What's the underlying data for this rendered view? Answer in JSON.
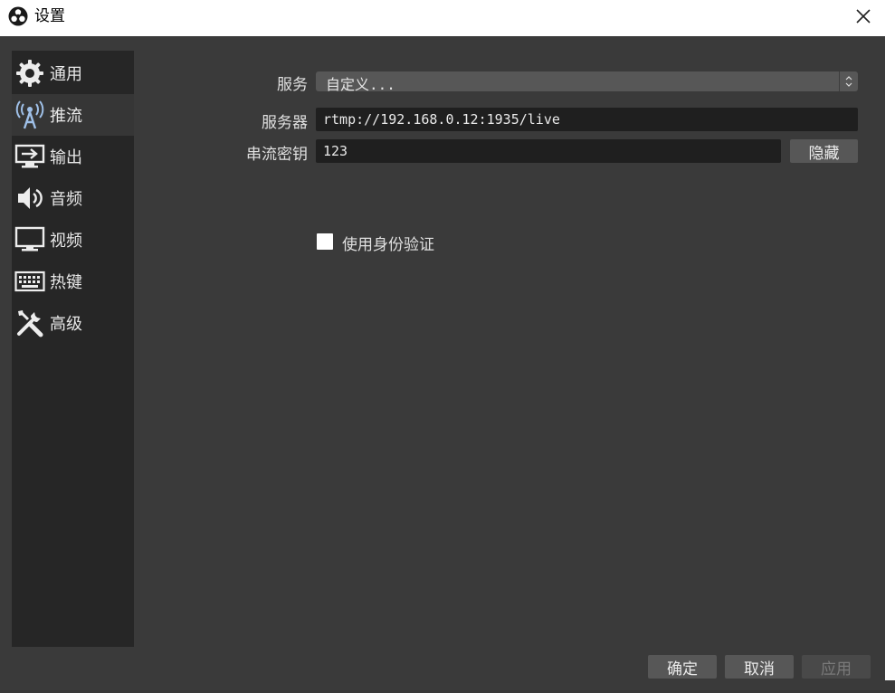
{
  "window": {
    "title": "设置"
  },
  "sidebar": {
    "items": [
      {
        "label": "通用",
        "icon": "gear-icon"
      },
      {
        "label": "推流",
        "icon": "antenna-icon"
      },
      {
        "label": "输出",
        "icon": "output-icon"
      },
      {
        "label": "音频",
        "icon": "speaker-icon"
      },
      {
        "label": "视频",
        "icon": "monitor-icon"
      },
      {
        "label": "热键",
        "icon": "keyboard-icon"
      },
      {
        "label": "高级",
        "icon": "tools-icon"
      }
    ],
    "active_index": 1
  },
  "stream": {
    "service_label": "服务",
    "service_value": "自定义...",
    "server_label": "服务器",
    "server_value": "rtmp://192.168.0.12:1935/live",
    "key_label": "串流密钥",
    "key_value": "123",
    "hide_button_label": "隐藏",
    "auth_label": "使用身份验证",
    "auth_checked": false
  },
  "footer": {
    "ok_label": "确定",
    "cancel_label": "取消",
    "apply_label": "应用"
  },
  "colors": {
    "background": "#3a3a3a",
    "sidebar": "#262626",
    "sidebar_active": "#363636",
    "input": "#1f1f1f",
    "button": "#575757"
  }
}
